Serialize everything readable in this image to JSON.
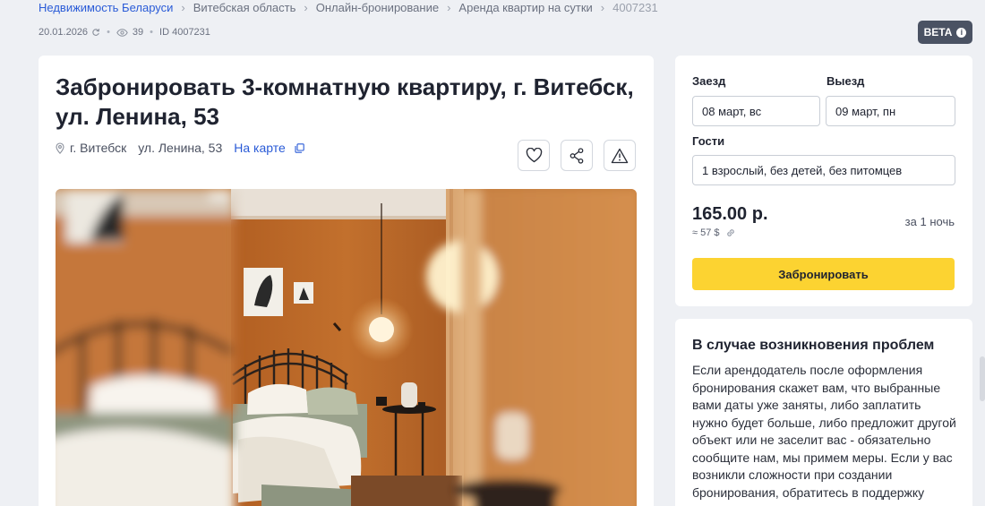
{
  "breadcrumbs": [
    {
      "label": "Недвижимость Беларуси",
      "link": true
    },
    {
      "label": "Витебская область",
      "link": false
    },
    {
      "label": "Онлайн-бронирование",
      "link": false
    },
    {
      "label": "Аренда квартир на сутки",
      "link": false
    },
    {
      "label": "4007231",
      "link": false
    }
  ],
  "meta": {
    "date": "20.01.2026",
    "views": "39",
    "id": "ID 4007231"
  },
  "beta_label": "BETA",
  "listing": {
    "title": "Забронировать 3-комнатную квартиру, г. Витебск, ул. Ленина, 53",
    "city": "г. Витебск",
    "street": "ул. Ленина, 53",
    "map_link": "На карте"
  },
  "booking": {
    "checkin_label": "Заезд",
    "checkin_value": "08 март, вс",
    "checkout_label": "Выезд",
    "checkout_value": "09 март, пн",
    "guests_label": "Гости",
    "guests_value": "1 взрослый, без детей, без питомцев",
    "price": "165.00 р.",
    "price_usd": "≈ 57 $",
    "period": "за 1 ночь",
    "book_button": "Забронировать"
  },
  "help": {
    "title": "В случае возникновения проблем",
    "text": "Если арендодатель после оформления бронирования скажет вам, что выбранные вами даты уже заняты, либо заплатить нужно будет больше, либо предложит другой объект или не заселит вас - обязательно сообщите нам, мы примем меры. Если у вас возникли сложности при создании бронирования, обратитесь в поддержку"
  },
  "colors": {
    "link": "#2a5bd7",
    "accent_button": "#fcd331",
    "beta_badge": "#4a5263",
    "background": "#eef0f4"
  },
  "icons": [
    "chevron-right-icon",
    "refresh-icon",
    "eye-icon",
    "info-icon",
    "map-pin-icon",
    "copy-icon",
    "heart-icon",
    "share-icon",
    "warning-icon",
    "link-icon"
  ]
}
